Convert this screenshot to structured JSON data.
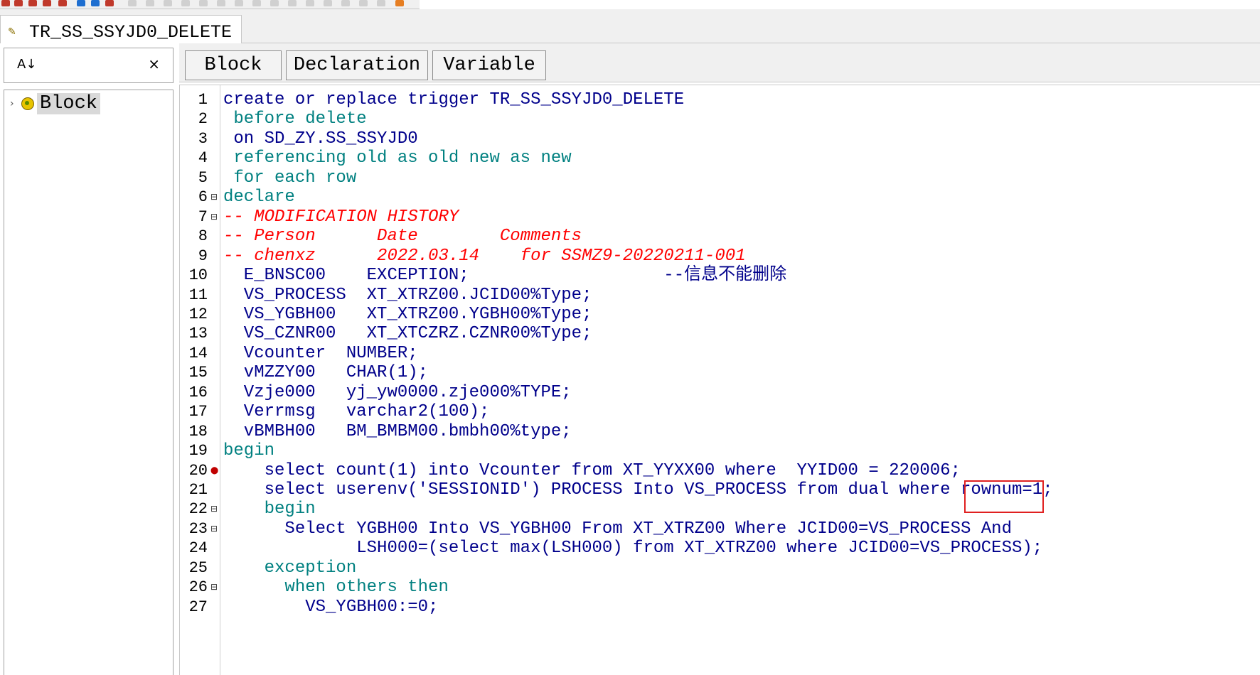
{
  "document_tab": {
    "title": "TR_SS_SSYJD0_DELETE",
    "icon": "trigger-icon"
  },
  "left_panel": {
    "sort_icon": "sort-az-icon",
    "sort_glyph": "A↓",
    "close_glyph": "×",
    "tree_item": "Block"
  },
  "editor_tabs": [
    "Block",
    "Declaration",
    "Variable"
  ],
  "code_lines": [
    "create or replace trigger TR_SS_SSYJD0_DELETE",
    " before delete",
    " on SD_ZY.SS_SSYJD0",
    " referencing old as old new as new",
    " for each row",
    "declare",
    "-- MODIFICATION HISTORY",
    "-- Person      Date        Comments",
    "-- chenxz      2022.03.14    for SSMZ9-20220211-001",
    "  E_BNSC00    EXCEPTION;                   --信息不能删除",
    "  VS_PROCESS  XT_XTRZ00.JCID00%Type;",
    "  VS_YGBH00   XT_XTRZ00.YGBH00%Type;",
    "  VS_CZNR00   XT_XTCZRZ.CZNR00%Type;",
    "  Vcounter  NUMBER;",
    "  vMZZY00   CHAR(1);",
    "  Vzje000   yj_yw0000.zje000%TYPE;",
    "  Verrmsg   varchar2(100);",
    "  vBMBH00   BM_BMBM00.bmbh00%type;",
    "begin",
    "    select count(1) into Vcounter from XT_YYXX00 where  YYID00 = 220006;",
    "    select userenv('SESSIONID') PROCESS Into VS_PROCESS from dual where rownum=1;",
    "    begin",
    "      Select YGBH00 Into VS_YGBH00 From XT_XTRZ00 Where JCID00=VS_PROCESS And",
    "             LSH000=(select max(LSH000) from XT_XTRZ00 where JCID00=VS_PROCESS);",
    "    exception",
    "      when others then",
    "        VS_YGBH00:=0;"
  ],
  "line_numbers": [
    "1",
    "2",
    "3",
    "4",
    "5",
    "6",
    "7",
    "8",
    "9",
    "10",
    "11",
    "12",
    "13",
    "14",
    "15",
    "16",
    "17",
    "18",
    "19",
    "20",
    "21",
    "22",
    "23",
    "24",
    "25",
    "26",
    "27"
  ],
  "colors": {
    "keyword": "#008080",
    "identifier": "#00008b",
    "comment": "#ff0000",
    "highlight_box": "#e02020"
  },
  "highlighted_value": "220006;"
}
